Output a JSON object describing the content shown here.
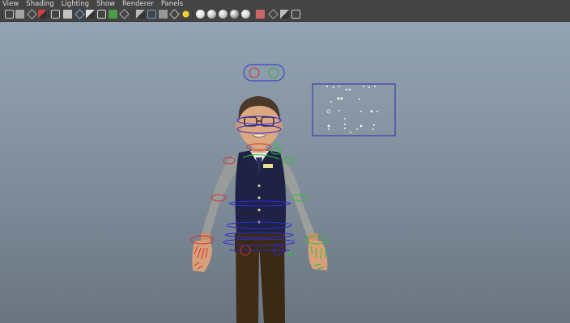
{
  "menu": {
    "items": [
      {
        "id": "view",
        "label": "View"
      },
      {
        "id": "shading",
        "label": "Shading"
      },
      {
        "id": "lighting",
        "label": "Lighting"
      },
      {
        "id": "show",
        "label": "Show"
      },
      {
        "id": "renderer",
        "label": "Renderer"
      },
      {
        "id": "panels",
        "label": "Panels"
      }
    ]
  },
  "toolbar": {
    "icons": [
      {
        "name": "select-camera-icon",
        "color": "#c8c8c8"
      },
      {
        "name": "camera-attributes-icon",
        "color": "#b0b0b0"
      },
      {
        "name": "bookmarks-icon",
        "color": "#c8c8c8"
      },
      {
        "name": "image-plane-icon",
        "color": "#d04040"
      },
      {
        "name": "wireframe-icon",
        "color": "#cfcfcf"
      },
      {
        "name": "grid-icon",
        "color": "#d0d0d0"
      },
      {
        "name": "film-gate-icon",
        "color": "#7fbfff"
      },
      {
        "name": "resolution-gate-icon",
        "color": "#e0e0e0"
      },
      {
        "name": "gate-mask-icon",
        "color": "#d8d8d8"
      },
      {
        "name": "field-chart-icon",
        "color": "#4aa84a"
      },
      {
        "name": "safe-action-icon",
        "color": "#cccccc"
      },
      {
        "name": "wireframe-shading-icon",
        "color": "#b8b8b8"
      },
      {
        "name": "smooth-shading-icon",
        "color": "#6a9fd8"
      },
      {
        "name": "wireframe-on-shaded-icon",
        "color": "#a0a0a0"
      },
      {
        "name": "textured-icon",
        "color": "#dcdcdc"
      },
      {
        "name": "use-all-lights-icon",
        "color": "#f0d030"
      },
      {
        "name": "shadows-icon",
        "color": "#dddddd"
      },
      {
        "name": "screen-space-ao-icon",
        "color": "#bbbbbb"
      },
      {
        "name": "motion-blur-icon",
        "color": "#c0c0c0"
      },
      {
        "name": "multisample-aa-icon",
        "color": "#9a9a9a"
      },
      {
        "name": "depth-of-field-icon",
        "color": "#cccccc"
      },
      {
        "name": "isolate-select-icon",
        "color": "#d86a6a"
      },
      {
        "name": "xray-icon",
        "color": "#bdbdbd"
      },
      {
        "name": "xray-active-components-icon",
        "color": "#bdbdbd"
      },
      {
        "name": "xray-joints-icon",
        "color": "#cfcfcf"
      }
    ]
  }
}
